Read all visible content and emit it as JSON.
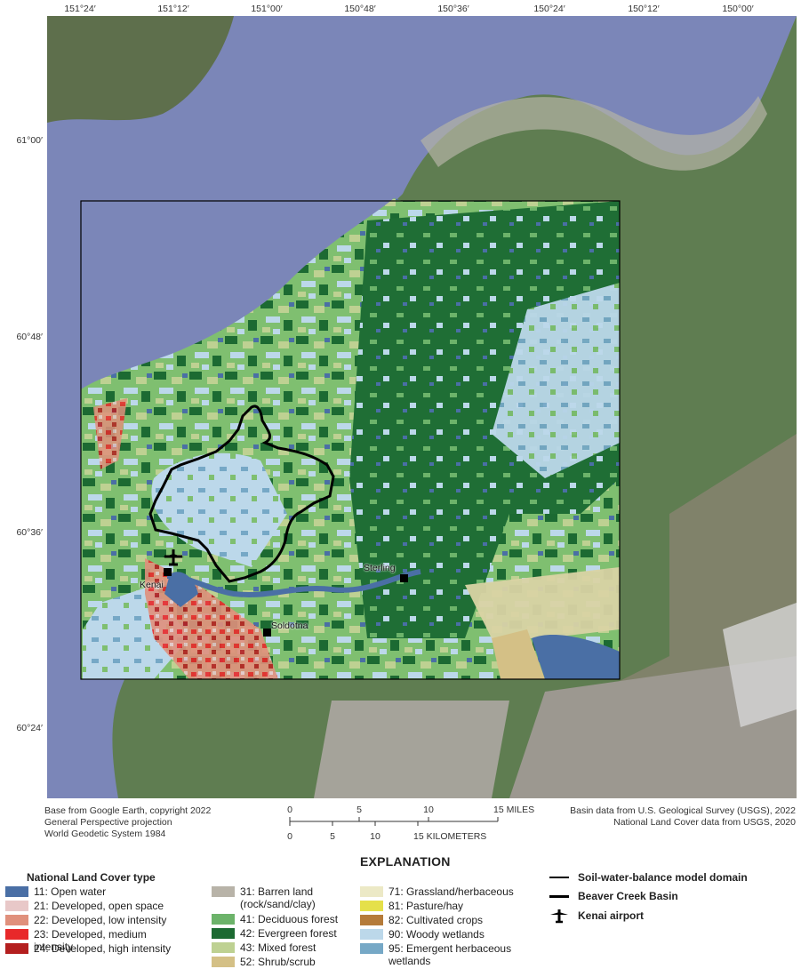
{
  "map": {
    "top_ticks": [
      "151°24′",
      "151°12′",
      "151°00′",
      "150°48′",
      "150°36′",
      "150°24′",
      "150°12′",
      "150°00′"
    ],
    "left_ticks": [
      "61°00′",
      "60°48′",
      "60°36′",
      "60°24′"
    ],
    "towns": {
      "kenai": "Kenai",
      "soldotna": "Soldotna",
      "sterling": "Sterling"
    }
  },
  "credits": {
    "left": [
      "Base from Google Earth, copyright 2022",
      "General Perspective projection",
      "World Geodetic System 1984"
    ],
    "right": [
      "Basin data from U.S. Geological Survey (USGS), 2022",
      "National Land Cover data from USGS, 2020"
    ]
  },
  "scalebar": {
    "miles": [
      "0",
      "5",
      "10",
      "15 MILES"
    ],
    "km": [
      "0",
      "5",
      "10",
      "15 KILOMETERS"
    ]
  },
  "explanation": {
    "title": "EXPLANATION",
    "land_cover_title": "National Land Cover type",
    "land_cover": [
      {
        "label": "11: Open water",
        "color": "#4a6fa5"
      },
      {
        "label": "21: Developed, open space",
        "color": "#e8c8c8"
      },
      {
        "label": "22: Developed, low intensity",
        "color": "#e0907c"
      },
      {
        "label": "23: Developed, medium intensity",
        "color": "#e8282a"
      },
      {
        "label": "24: Developed, high intensity",
        "color": "#b41f1f"
      },
      {
        "label": "31: Barren land (rock/sand/clay)",
        "color": "#b8b3a8"
      },
      {
        "label": "41: Deciduous forest",
        "color": "#6cb36a"
      },
      {
        "label": "42: Evergreen forest",
        "color": "#1c6a32"
      },
      {
        "label": "43: Mixed forest",
        "color": "#bed192"
      },
      {
        "label": "52: Shrub/scrub",
        "color": "#d4c086"
      },
      {
        "label": "71: Grassland/herbaceous",
        "color": "#ece9c6"
      },
      {
        "label": "81: Pasture/hay",
        "color": "#e5e04a"
      },
      {
        "label": "82: Cultivated crops",
        "color": "#b57b3a"
      },
      {
        "label": "90: Woody wetlands",
        "color": "#bcd8ea"
      },
      {
        "label": "95: Emergent herbaceous wetlands",
        "color": "#76a8c6"
      }
    ],
    "symbols": {
      "domain": "Soil-water-balance model domain",
      "basin": "Beaver Creek Basin",
      "airport": "Kenai airport"
    }
  }
}
